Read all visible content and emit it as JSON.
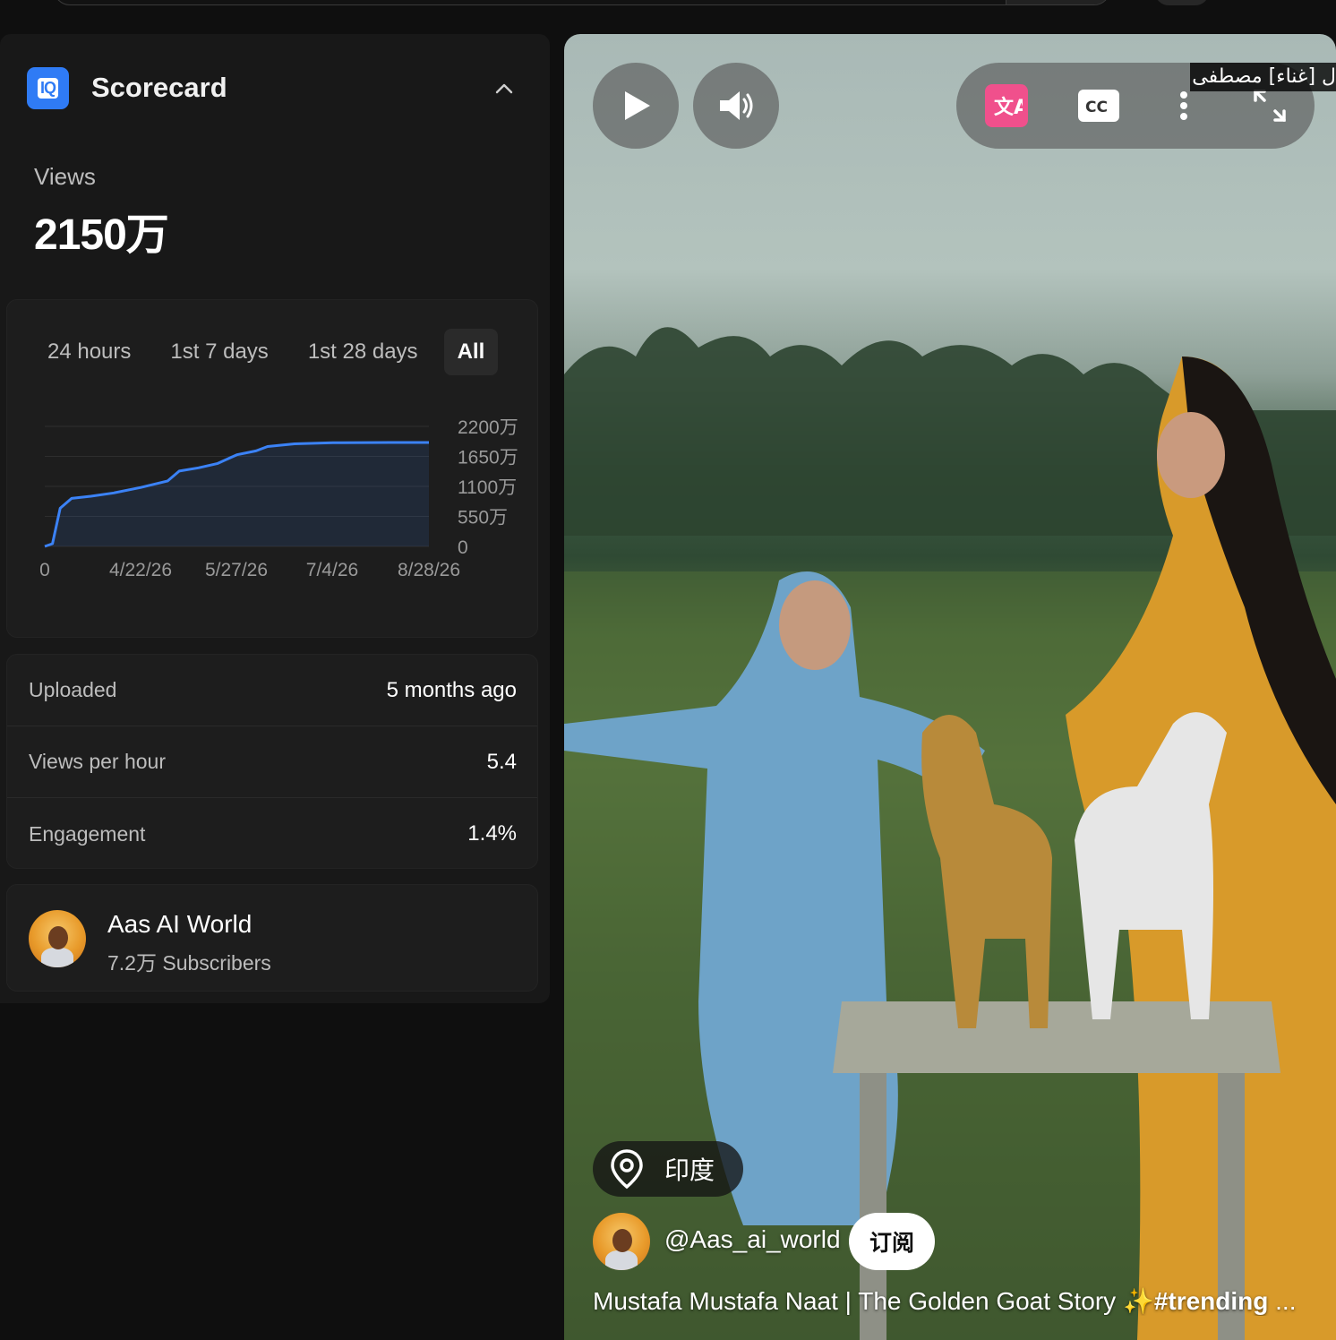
{
  "panel": {
    "title": "Scorecard",
    "views_label": "Views",
    "views_value": "2150万"
  },
  "tabs": [
    {
      "label": "24 hours",
      "active": false
    },
    {
      "label": "1st 7 days",
      "active": false
    },
    {
      "label": "1st 28 days",
      "active": false
    },
    {
      "label": "All",
      "active": true
    }
  ],
  "chart_data": {
    "type": "area",
    "x_tick_labels": [
      "0",
      "4/22/26",
      "5/27/26",
      "7/4/26",
      "8/28/26"
    ],
    "y_tick_labels": [
      "2200万",
      "1650万",
      "1100万",
      "550万",
      "0"
    ],
    "ylim": [
      0,
      2200
    ],
    "y_unit": "万",
    "series": [
      {
        "color": "#3b82f6",
        "points": [
          [
            0,
            0
          ],
          [
            2,
            50
          ],
          [
            4,
            700
          ],
          [
            7,
            880
          ],
          [
            12,
            920
          ],
          [
            18,
            980
          ],
          [
            25,
            1080
          ],
          [
            32,
            1200
          ],
          [
            35,
            1380
          ],
          [
            40,
            1440
          ],
          [
            45,
            1520
          ],
          [
            50,
            1680
          ],
          [
            55,
            1750
          ],
          [
            58,
            1830
          ],
          [
            65,
            1880
          ],
          [
            75,
            1900
          ],
          [
            90,
            1905
          ],
          [
            100,
            1905
          ]
        ]
      }
    ],
    "grid": true
  },
  "stats": [
    {
      "label": "Uploaded",
      "value": "5 months ago"
    },
    {
      "label": "Views per hour",
      "value": "5.4"
    },
    {
      "label": "Engagement",
      "value": "1.4%"
    }
  ],
  "channel": {
    "name": "Aas AI World",
    "subscribers": "7.2万 Subscribers"
  },
  "video": {
    "caption_overlay": "ل [غناء] مصطفى",
    "location": "印度",
    "handle": "@Aas_ai_world",
    "subscribe_label": "订阅",
    "title_plain": "Mustafa Mustafa Naat | The Golden Goat Story ✨",
    "title_tag": "#trending",
    "title_ellipsis": " ..."
  },
  "colors": {
    "accent": "#3b82f6",
    "logo": "#2f7bf5",
    "translate_icon": "#f0508c"
  },
  "icons": {
    "play": "play-icon",
    "volume": "volume-icon",
    "translate": "translate-icon",
    "captions": "cc-icon",
    "more": "more-vert-icon",
    "fullscreen": "fullscreen-icon",
    "location": "location-pin-icon",
    "collapse": "chevron-up-icon"
  }
}
